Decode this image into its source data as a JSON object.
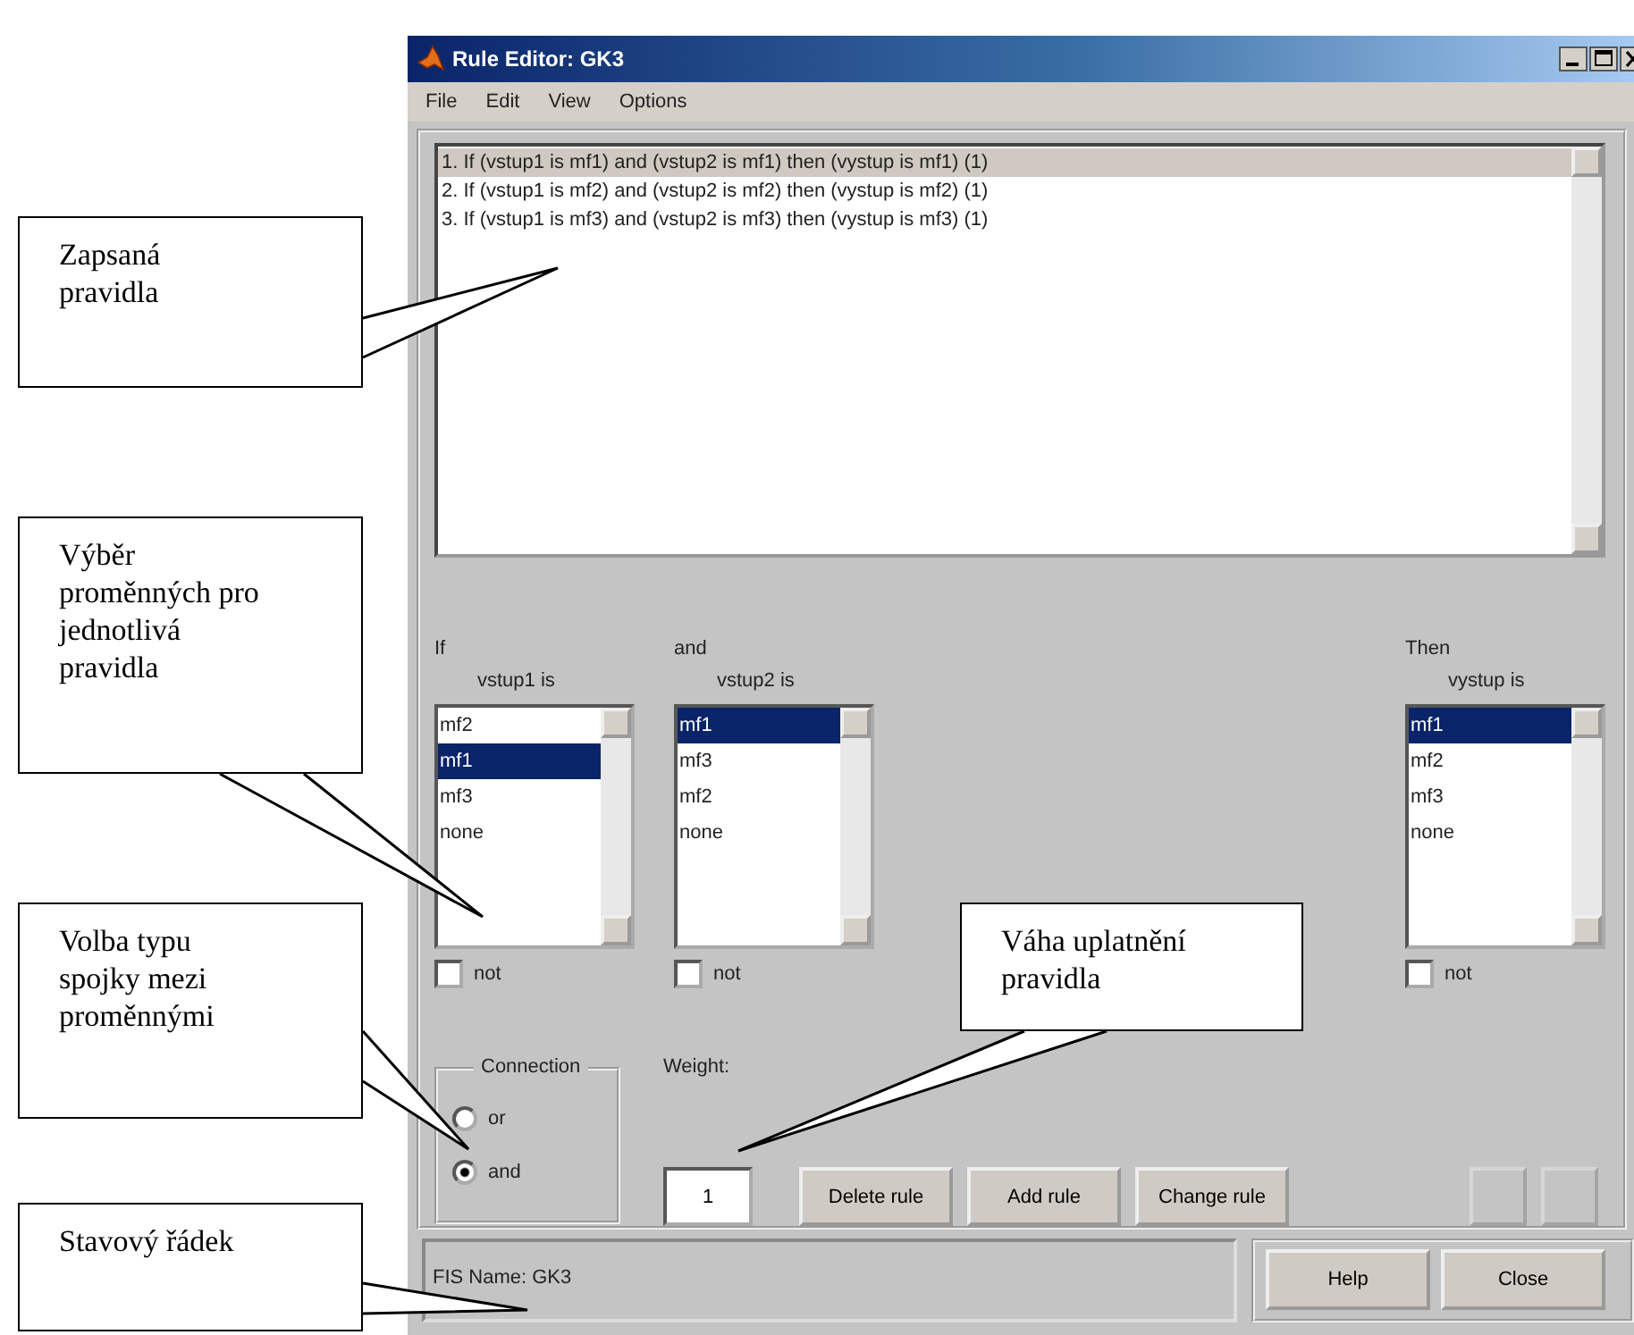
{
  "window": {
    "title": "Rule Editor: GK3"
  },
  "menu": [
    {
      "label": "File"
    },
    {
      "label": "Edit"
    },
    {
      "label": "View"
    },
    {
      "label": "Options"
    }
  ],
  "rules": [
    {
      "text": "1. If (vstup1 is mf1) and (vstup2 is mf1) then (vystup is mf1) (1)",
      "selected": true
    },
    {
      "text": "2. If (vstup1 is mf2) and (vstup2 is mf2) then (vystup is mf2) (1)",
      "selected": false
    },
    {
      "text": "3. If (vstup1 is mf3) and (vstup2 is mf3) then (vystup is mf3) (1)",
      "selected": false
    }
  ],
  "variables": [
    {
      "header": "If",
      "label": "vstup1 is",
      "not_label": "not",
      "not_checked": false,
      "options": [
        {
          "label": "mf2",
          "selected": false
        },
        {
          "label": "mf1",
          "selected": true
        },
        {
          "label": "mf3",
          "selected": false
        },
        {
          "label": "none",
          "selected": false
        }
      ]
    },
    {
      "header": "and",
      "label": "vstup2 is",
      "not_label": "not",
      "not_checked": false,
      "options": [
        {
          "label": "mf1",
          "selected": true
        },
        {
          "label": "mf3",
          "selected": false
        },
        {
          "label": "mf2",
          "selected": false
        },
        {
          "label": "none",
          "selected": false
        }
      ]
    },
    {
      "header": "Then",
      "label": "vystup is",
      "not_label": "not",
      "not_checked": false,
      "options": [
        {
          "label": "mf1",
          "selected": true
        },
        {
          "label": "mf2",
          "selected": false
        },
        {
          "label": "mf3",
          "selected": false
        },
        {
          "label": "none",
          "selected": false
        }
      ]
    }
  ],
  "connection": {
    "title": "Connection",
    "options": [
      {
        "label": "or",
        "selected": false
      },
      {
        "label": "and",
        "selected": true
      }
    ]
  },
  "weight": {
    "label": "Weight:",
    "value": "1"
  },
  "buttons": [
    {
      "label": "Delete rule"
    },
    {
      "label": "Add rule"
    },
    {
      "label": "Change rule"
    }
  ],
  "nav_buttons": [
    {
      "disabled": true
    },
    {
      "disabled": true
    }
  ],
  "status": {
    "text": "FIS Name: GK3"
  },
  "footer_buttons": [
    {
      "label": "Help"
    },
    {
      "label": "Close"
    }
  ],
  "annotations": [
    {
      "text": "Zapsaná pravidla"
    },
    {
      "text": "Výběr proměnných pro jednotlivá pravidla"
    },
    {
      "text": "Volba typu spojky mezi proměnnými"
    },
    {
      "text": "Stavový řádek"
    },
    {
      "text": "Váha uplatnění pravidla"
    }
  ]
}
